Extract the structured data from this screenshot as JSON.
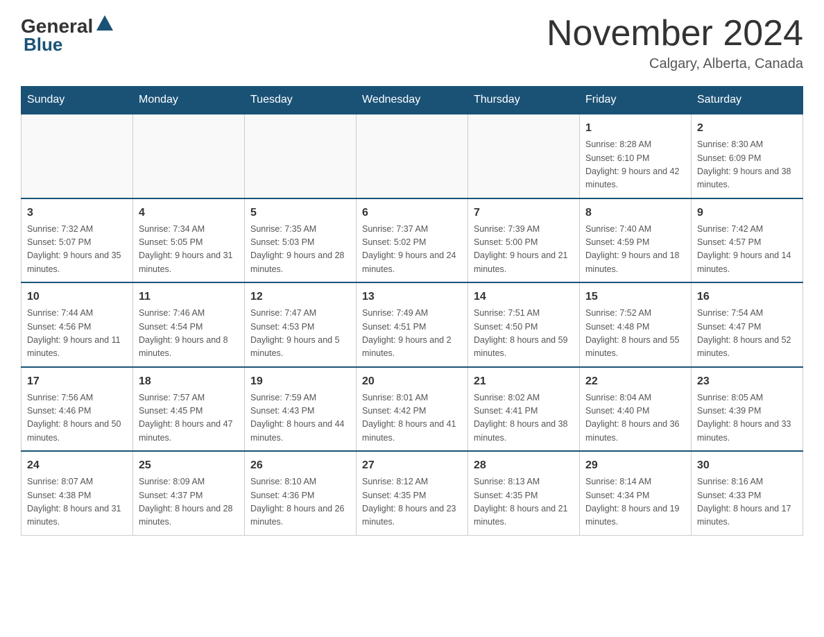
{
  "header": {
    "logo_general": "General",
    "logo_blue": "Blue",
    "title": "November 2024",
    "subtitle": "Calgary, Alberta, Canada"
  },
  "days_of_week": [
    "Sunday",
    "Monday",
    "Tuesday",
    "Wednesday",
    "Thursday",
    "Friday",
    "Saturday"
  ],
  "weeks": [
    [
      {
        "day": "",
        "info": ""
      },
      {
        "day": "",
        "info": ""
      },
      {
        "day": "",
        "info": ""
      },
      {
        "day": "",
        "info": ""
      },
      {
        "day": "",
        "info": ""
      },
      {
        "day": "1",
        "info": "Sunrise: 8:28 AM\nSunset: 6:10 PM\nDaylight: 9 hours and 42 minutes."
      },
      {
        "day": "2",
        "info": "Sunrise: 8:30 AM\nSunset: 6:09 PM\nDaylight: 9 hours and 38 minutes."
      }
    ],
    [
      {
        "day": "3",
        "info": "Sunrise: 7:32 AM\nSunset: 5:07 PM\nDaylight: 9 hours and 35 minutes."
      },
      {
        "day": "4",
        "info": "Sunrise: 7:34 AM\nSunset: 5:05 PM\nDaylight: 9 hours and 31 minutes."
      },
      {
        "day": "5",
        "info": "Sunrise: 7:35 AM\nSunset: 5:03 PM\nDaylight: 9 hours and 28 minutes."
      },
      {
        "day": "6",
        "info": "Sunrise: 7:37 AM\nSunset: 5:02 PM\nDaylight: 9 hours and 24 minutes."
      },
      {
        "day": "7",
        "info": "Sunrise: 7:39 AM\nSunset: 5:00 PM\nDaylight: 9 hours and 21 minutes."
      },
      {
        "day": "8",
        "info": "Sunrise: 7:40 AM\nSunset: 4:59 PM\nDaylight: 9 hours and 18 minutes."
      },
      {
        "day": "9",
        "info": "Sunrise: 7:42 AM\nSunset: 4:57 PM\nDaylight: 9 hours and 14 minutes."
      }
    ],
    [
      {
        "day": "10",
        "info": "Sunrise: 7:44 AM\nSunset: 4:56 PM\nDaylight: 9 hours and 11 minutes."
      },
      {
        "day": "11",
        "info": "Sunrise: 7:46 AM\nSunset: 4:54 PM\nDaylight: 9 hours and 8 minutes."
      },
      {
        "day": "12",
        "info": "Sunrise: 7:47 AM\nSunset: 4:53 PM\nDaylight: 9 hours and 5 minutes."
      },
      {
        "day": "13",
        "info": "Sunrise: 7:49 AM\nSunset: 4:51 PM\nDaylight: 9 hours and 2 minutes."
      },
      {
        "day": "14",
        "info": "Sunrise: 7:51 AM\nSunset: 4:50 PM\nDaylight: 8 hours and 59 minutes."
      },
      {
        "day": "15",
        "info": "Sunrise: 7:52 AM\nSunset: 4:48 PM\nDaylight: 8 hours and 55 minutes."
      },
      {
        "day": "16",
        "info": "Sunrise: 7:54 AM\nSunset: 4:47 PM\nDaylight: 8 hours and 52 minutes."
      }
    ],
    [
      {
        "day": "17",
        "info": "Sunrise: 7:56 AM\nSunset: 4:46 PM\nDaylight: 8 hours and 50 minutes."
      },
      {
        "day": "18",
        "info": "Sunrise: 7:57 AM\nSunset: 4:45 PM\nDaylight: 8 hours and 47 minutes."
      },
      {
        "day": "19",
        "info": "Sunrise: 7:59 AM\nSunset: 4:43 PM\nDaylight: 8 hours and 44 minutes."
      },
      {
        "day": "20",
        "info": "Sunrise: 8:01 AM\nSunset: 4:42 PM\nDaylight: 8 hours and 41 minutes."
      },
      {
        "day": "21",
        "info": "Sunrise: 8:02 AM\nSunset: 4:41 PM\nDaylight: 8 hours and 38 minutes."
      },
      {
        "day": "22",
        "info": "Sunrise: 8:04 AM\nSunset: 4:40 PM\nDaylight: 8 hours and 36 minutes."
      },
      {
        "day": "23",
        "info": "Sunrise: 8:05 AM\nSunset: 4:39 PM\nDaylight: 8 hours and 33 minutes."
      }
    ],
    [
      {
        "day": "24",
        "info": "Sunrise: 8:07 AM\nSunset: 4:38 PM\nDaylight: 8 hours and 31 minutes."
      },
      {
        "day": "25",
        "info": "Sunrise: 8:09 AM\nSunset: 4:37 PM\nDaylight: 8 hours and 28 minutes."
      },
      {
        "day": "26",
        "info": "Sunrise: 8:10 AM\nSunset: 4:36 PM\nDaylight: 8 hours and 26 minutes."
      },
      {
        "day": "27",
        "info": "Sunrise: 8:12 AM\nSunset: 4:35 PM\nDaylight: 8 hours and 23 minutes."
      },
      {
        "day": "28",
        "info": "Sunrise: 8:13 AM\nSunset: 4:35 PM\nDaylight: 8 hours and 21 minutes."
      },
      {
        "day": "29",
        "info": "Sunrise: 8:14 AM\nSunset: 4:34 PM\nDaylight: 8 hours and 19 minutes."
      },
      {
        "day": "30",
        "info": "Sunrise: 8:16 AM\nSunset: 4:33 PM\nDaylight: 8 hours and 17 minutes."
      }
    ]
  ]
}
